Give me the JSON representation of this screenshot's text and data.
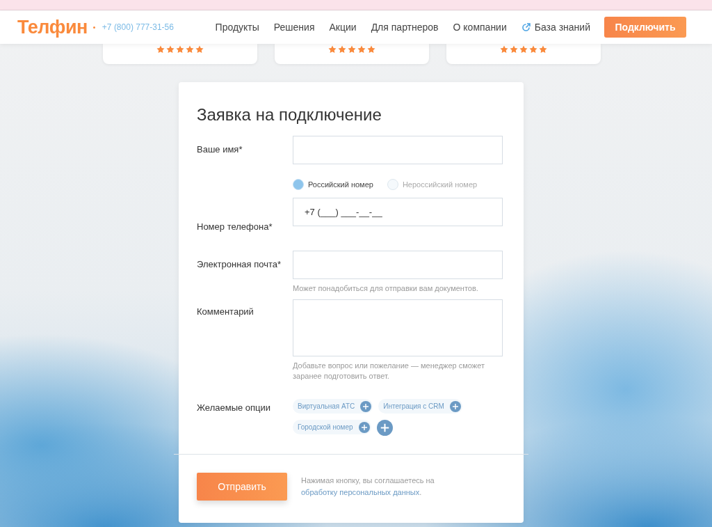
{
  "header": {
    "logo": "Телфин",
    "phone": "+7 (800) 777-31-56",
    "nav": [
      {
        "label": "Продукты",
        "kind": "plain"
      },
      {
        "label": "Решения",
        "kind": "plain"
      },
      {
        "label": "Акции",
        "kind": "plain"
      },
      {
        "label": "Для партнеров",
        "kind": "plain"
      },
      {
        "label": "О компании",
        "kind": "plain"
      },
      {
        "label": "База знаний",
        "kind": "external"
      }
    ],
    "cta": "Подключить"
  },
  "reviews": [
    {
      "stars": 5
    },
    {
      "stars": 5
    },
    {
      "stars": 5
    }
  ],
  "form": {
    "title": "Заявка на подключение",
    "name": {
      "label": "Ваше имя*"
    },
    "phone": {
      "label": "Номер телефона*",
      "value": "+7 (___) ___-__-__",
      "types": [
        {
          "label": "Российский номер",
          "selected": true
        },
        {
          "label": "Нероссийский номер",
          "selected": false
        }
      ]
    },
    "email": {
      "label": "Электронная почта*",
      "hint": "Может понадобиться для отправки вам документов."
    },
    "comment": {
      "label": "Комментарий",
      "hint": "Добавьте вопрос или пожелание — менеджер сможет заранее подготовить ответ."
    },
    "options": {
      "label": "Желаемые опции",
      "items": [
        {
          "label": "Виртуальная АТС"
        },
        {
          "label": "Интеграция с CRM"
        },
        {
          "label": "Городской номер"
        }
      ]
    },
    "submit": "Отправить",
    "consent": {
      "text": "Нажимая кнопку, вы соглашаетесь на ",
      "link": "обработку персональных данных",
      "end": "."
    }
  }
}
